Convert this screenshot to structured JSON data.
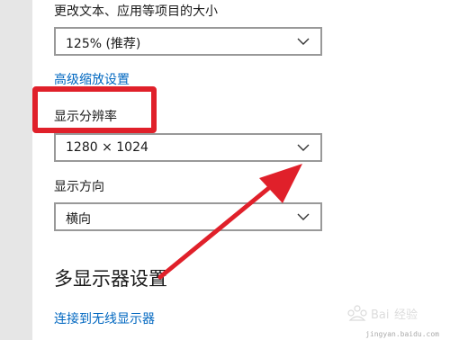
{
  "scale": {
    "label": "更改文本、应用等项目的大小",
    "value": "125% (推荐)"
  },
  "advanced_scaling_link": "高级缩放设置",
  "resolution": {
    "label": "显示分辨率",
    "value": "1280 × 1024"
  },
  "orientation": {
    "label": "显示方向",
    "value": "横向"
  },
  "multi_display": {
    "title": "多显示器设置",
    "connect_link": "连接到无线显示器"
  },
  "watermark": {
    "text": "jingyan.baidu.com"
  },
  "colors": {
    "link": "#0067c0",
    "annotation": "#e0202a",
    "dropdown_border": "#999999"
  },
  "icons": {
    "dropdown": "chevron-down-icon",
    "annotation": "arrow-icon"
  }
}
